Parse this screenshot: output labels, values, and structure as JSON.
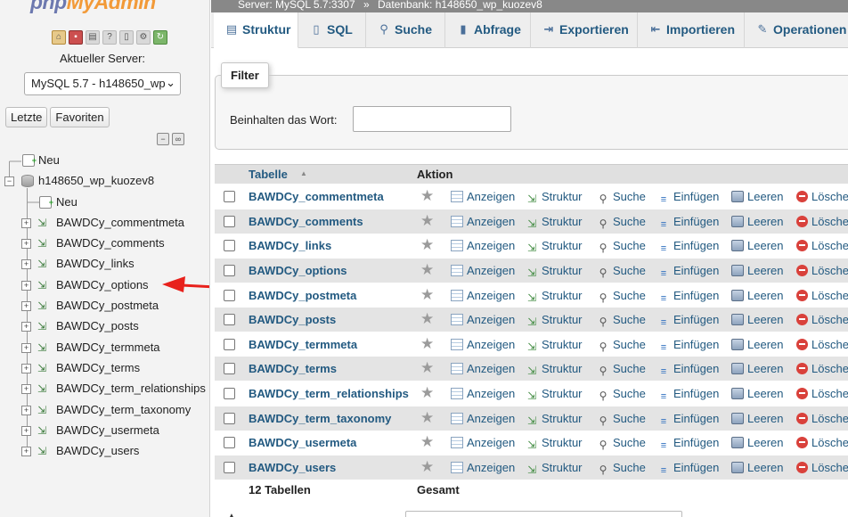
{
  "app": {
    "logo_php": "php",
    "logo_myadmin": "MyAdmin"
  },
  "breadcrumb": {
    "server": "Server: MySQL 5.7:3307",
    "separator": "»",
    "database": "Datenbank: h148650_wp_kuozev8"
  },
  "quick_icons": [
    "home-icon",
    "exit-icon",
    "sql-query-icon",
    "help-icon",
    "docs-icon",
    "settings-icon",
    "reload-icon"
  ],
  "nav": {
    "server_label": "Aktueller Server:",
    "server_select": "MySQL 5.7 - h148650_wp",
    "tabs": [
      "Letzte",
      "Favoriten"
    ],
    "new_server": "Neu",
    "database": "h148650_wp_kuozev8",
    "new_table": "Neu",
    "tables": [
      "BAWDCy_commentmeta",
      "BAWDCy_comments",
      "BAWDCy_links",
      "BAWDCy_options",
      "BAWDCy_postmeta",
      "BAWDCy_posts",
      "BAWDCy_termmeta",
      "BAWDCy_terms",
      "BAWDCy_term_relationships",
      "BAWDCy_term_taxonomy",
      "BAWDCy_usermeta",
      "BAWDCy_users"
    ]
  },
  "tabs": [
    {
      "label": "Struktur",
      "icon": "structure-icon",
      "active": true
    },
    {
      "label": "SQL",
      "icon": "sql-icon"
    },
    {
      "label": "Suche",
      "icon": "search-icon"
    },
    {
      "label": "Abfrage",
      "icon": "query-icon"
    },
    {
      "label": "Exportieren",
      "icon": "export-icon"
    },
    {
      "label": "Importieren",
      "icon": "import-icon"
    },
    {
      "label": "Operationen",
      "icon": "wrench-icon"
    }
  ],
  "filter": {
    "title": "Filter",
    "label": "Beinhalten das Wort:",
    "value": ""
  },
  "table": {
    "col_table": "Tabelle",
    "col_action": "Aktion",
    "actions": {
      "browse": "Anzeigen",
      "structure": "Struktur",
      "search": "Suche",
      "insert": "Einfügen",
      "empty": "Leeren",
      "drop": "Lösche"
    },
    "rows": [
      "BAWDCy_commentmeta",
      "BAWDCy_comments",
      "BAWDCy_links",
      "BAWDCy_options",
      "BAWDCy_postmeta",
      "BAWDCy_posts",
      "BAWDCy_termmeta",
      "BAWDCy_terms",
      "BAWDCy_term_relationships",
      "BAWDCy_term_taxonomy",
      "BAWDCy_usermeta",
      "BAWDCy_users"
    ],
    "footer_count": "12 Tabellen",
    "footer_sum": "Gesamt"
  },
  "colors": {
    "link": "#235a81",
    "arrow": "#e8211c",
    "logo_php": "#6c78af",
    "logo_myadmin": "#f29a38"
  }
}
